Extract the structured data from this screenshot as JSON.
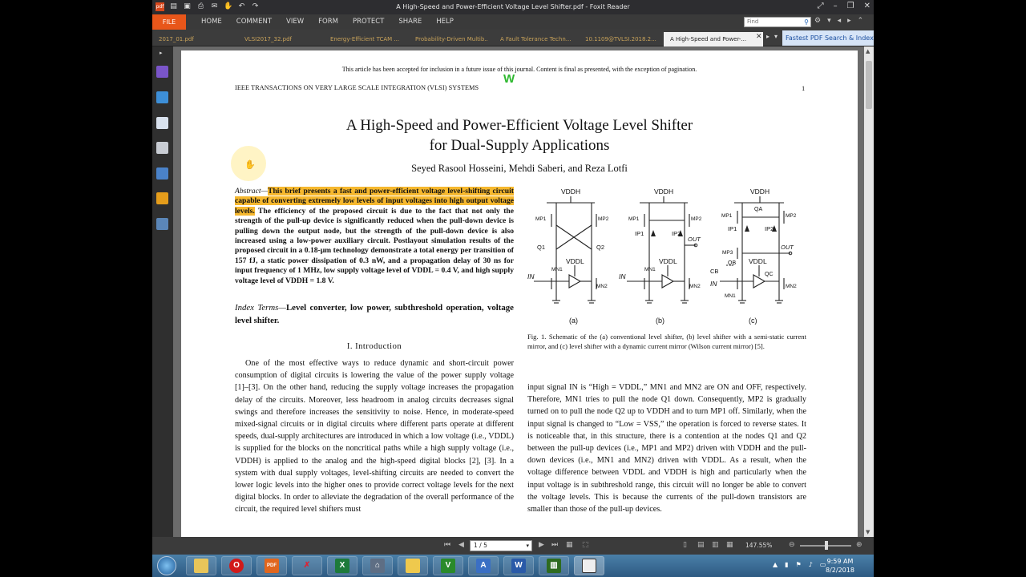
{
  "app": {
    "title": "A High-Speed and Power-Efficient Voltage Level Shifter.pdf - Foxit Reader",
    "file_label": "FILE",
    "menu": [
      "HOME",
      "COMMENT",
      "VIEW",
      "FORM",
      "PROTECT",
      "SHARE",
      "HELP"
    ],
    "find_placeholder": "Find",
    "promo": "Fastest PDF Search & Index"
  },
  "tabs": [
    {
      "label": "2017_01.pdf",
      "active": false
    },
    {
      "label": "VLSI2017_32.pdf",
      "active": false
    },
    {
      "label": "Energy-Efficient TCAM ...",
      "active": false
    },
    {
      "label": "Probability-Driven Multib...",
      "active": false
    },
    {
      "label": "A Fault Tolerance Techn...",
      "active": false
    },
    {
      "label": "10.1109@TVLSI.2018.2...",
      "active": false
    },
    {
      "label": "A High-Speed and Power-...",
      "active": true
    }
  ],
  "document": {
    "notice": "This article has been accepted for inclusion in a future issue of this journal. Content is final as presented, with the exception of pagination.",
    "journal": "IEEE TRANSACTIONS ON VERY LARGE SCALE INTEGRATION (VLSI) SYSTEMS",
    "page_number": "1",
    "title_line1": "A High-Speed and Power-Efficient Voltage Level Shifter",
    "title_line2": "for Dual-Supply Applications",
    "authors": "Seyed Rasool Hosseini, Mehdi Saberi, and Reza Lotfi",
    "abstract_label": "Abstract—",
    "abstract_highlight": "This brief presents a fast and power-efficient voltage level-shifting circuit capable of converting extremely low levels of input voltages into high output voltage levels.",
    "abstract_rest": " The efficiency of the proposed circuit is due to the fact that not only the strength of the pull-up device is significantly reduced when the pull-down device is pulling down the output node, but the strength of the pull-down device is also increased using a low-power auxiliary circuit. Postlayout simulation results of the proposed circuit in a 0.18-μm technology demonstrate a total energy per transition of 157 fJ, a static power dissipation of 0.3 nW, and a propagation delay of 30 ns for input frequency of 1 MHz, low supply voltage level of VDDL = 0.4 V, and high supply voltage level of VDDH = 1.8 V.",
    "index_label": "Index Terms—",
    "index_terms": "Level converter, low power, subthreshold operation, voltage level shifter.",
    "section_heading": "I. Introduction",
    "intro_text": "One of the most effective ways to reduce dynamic and short-circuit power consumption of digital circuits is lowering the value of the power supply voltage [1]–[3]. On the other hand, reducing the supply voltage increases the propagation delay of the circuits. Moreover, less headroom in analog circuits decreases signal swings and therefore increases the sensitivity to noise. Hence, in moderate-speed mixed-signal circuits or in digital circuits where different parts operate at different speeds, dual-supply architectures are introduced in which a low voltage (i.e., VDDL) is supplied for the blocks on the noncritical paths while a high supply voltage (i.e., VDDH) is applied to the analog and the high-speed digital blocks [2], [3]. In a system with dual supply voltages, level-shifting circuits are needed to convert the lower logic levels into the higher ones to provide correct voltage levels for the next digital blocks. In order to alleviate the degradation of the overall performance of the circuit, the required level shifters must",
    "fig_caption": "Fig. 1.   Schematic of the (a) conventional level shifter, (b) level shifter with a semi-static current mirror, and (c) level shifter with a dynamic current mirror (Wilson current mirror) [5].",
    "right_text": "input signal IN is “High = VDDL,” MN1 and MN2 are ON and OFF, respectively. Therefore, MN1 tries to pull the node Q1 down. Consequently, MP2 is gradually turned on to pull the node Q2 up to VDDH and to turn MP1 off. Similarly, when the input signal is changed to “Low = VSS,” the operation is forced to reverse states. It is noticeable that, in this structure, there is a contention at the nodes Q1 and Q2 between the pull-up devices (i.e., MP1 and MP2) driven with VDDH and the pull-down devices (i.e., MN1 and MN2) driven with VDDL. As a result, when the voltage difference between VDDL and VDDH is high and particularly when the input voltage is in subthreshold range, this circuit will no longer be able to convert the voltage levels. This is because the currents of the pull-down transistors are smaller than those of the pull-up devices.",
    "fig_labels": {
      "a": "(a)",
      "b": "(b)",
      "c": "(c)",
      "vddh": "VDDH",
      "vddl": "VDDL",
      "in": "IN",
      "out": "OUT",
      "mp1": "MP1",
      "mp2": "MP2",
      "mn1": "MN1",
      "mn2": "MN2",
      "q1": "Q1",
      "q2": "Q2",
      "ip1": "IP1",
      "ip2": "IP2",
      "mp3": "MP3",
      "qa": "QA",
      "qb": "QB",
      "qc": "QC",
      "cb": "CB"
    }
  },
  "statusbar": {
    "page_field": "1 / 5",
    "zoom": "147.55%"
  },
  "taskbar": {
    "time": "9:59 AM",
    "date": "8/2/2018"
  },
  "colors": {
    "highlight": "#f6b82e",
    "file_tab": "#e8561a",
    "watermark": "#2fb830"
  }
}
